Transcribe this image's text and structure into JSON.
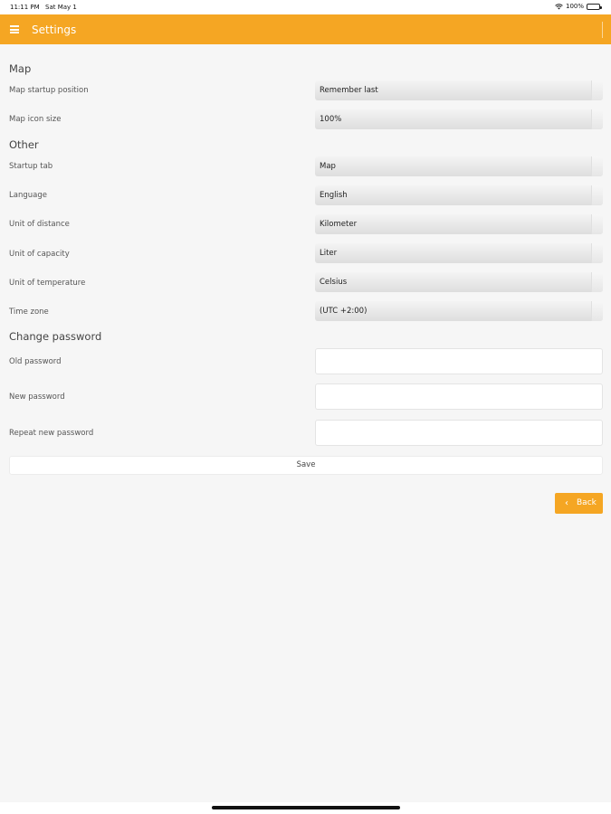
{
  "status_bar": {
    "time": "11:11 PM",
    "date": "Sat May 1",
    "battery": "100%"
  },
  "header": {
    "title": "Settings"
  },
  "sections": {
    "map": "Map",
    "other": "Other",
    "change_password": "Change password"
  },
  "fields": {
    "map_startup_position": {
      "label": "Map startup position",
      "value": "Remember last"
    },
    "map_icon_size": {
      "label": "Map icon size",
      "value": "100%"
    },
    "startup_tab": {
      "label": "Startup tab",
      "value": "Map"
    },
    "language": {
      "label": "Language",
      "value": "English"
    },
    "unit_of_distance": {
      "label": "Unit of distance",
      "value": "Kilometer"
    },
    "unit_of_capacity": {
      "label": "Unit of capacity",
      "value": "Liter"
    },
    "unit_of_temperature": {
      "label": "Unit of temperature",
      "value": "Celsius"
    },
    "time_zone": {
      "label": "Time zone",
      "value": "(UTC +2:00)"
    },
    "old_password": {
      "label": "Old password",
      "value": ""
    },
    "new_password": {
      "label": "New password",
      "value": ""
    },
    "repeat_new_password": {
      "label": "Repeat new password",
      "value": ""
    }
  },
  "buttons": {
    "save": "Save",
    "back": "Back"
  },
  "colors": {
    "accent": "#f5a623",
    "background": "#f6f6f6"
  },
  "icons": {
    "menu": "menu-icon",
    "back": "chevron-left-icon",
    "wifi": "wifi-icon",
    "battery": "battery-icon"
  }
}
